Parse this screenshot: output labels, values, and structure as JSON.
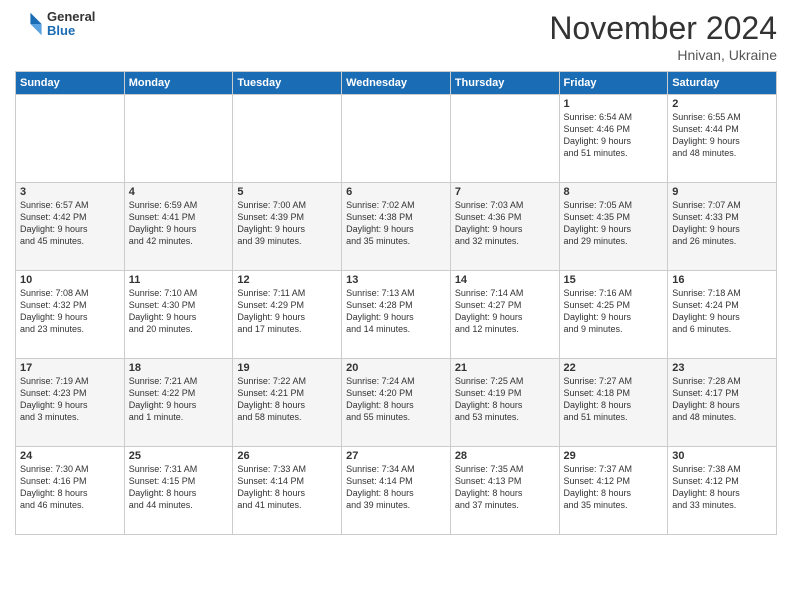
{
  "header": {
    "logo_line1": "General",
    "logo_line2": "Blue",
    "month": "November 2024",
    "location": "Hnivan, Ukraine"
  },
  "weekdays": [
    "Sunday",
    "Monday",
    "Tuesday",
    "Wednesday",
    "Thursday",
    "Friday",
    "Saturday"
  ],
  "weeks": [
    [
      {
        "num": "",
        "info": ""
      },
      {
        "num": "",
        "info": ""
      },
      {
        "num": "",
        "info": ""
      },
      {
        "num": "",
        "info": ""
      },
      {
        "num": "",
        "info": ""
      },
      {
        "num": "1",
        "info": "Sunrise: 6:54 AM\nSunset: 4:46 PM\nDaylight: 9 hours\nand 51 minutes."
      },
      {
        "num": "2",
        "info": "Sunrise: 6:55 AM\nSunset: 4:44 PM\nDaylight: 9 hours\nand 48 minutes."
      }
    ],
    [
      {
        "num": "3",
        "info": "Sunrise: 6:57 AM\nSunset: 4:42 PM\nDaylight: 9 hours\nand 45 minutes."
      },
      {
        "num": "4",
        "info": "Sunrise: 6:59 AM\nSunset: 4:41 PM\nDaylight: 9 hours\nand 42 minutes."
      },
      {
        "num": "5",
        "info": "Sunrise: 7:00 AM\nSunset: 4:39 PM\nDaylight: 9 hours\nand 39 minutes."
      },
      {
        "num": "6",
        "info": "Sunrise: 7:02 AM\nSunset: 4:38 PM\nDaylight: 9 hours\nand 35 minutes."
      },
      {
        "num": "7",
        "info": "Sunrise: 7:03 AM\nSunset: 4:36 PM\nDaylight: 9 hours\nand 32 minutes."
      },
      {
        "num": "8",
        "info": "Sunrise: 7:05 AM\nSunset: 4:35 PM\nDaylight: 9 hours\nand 29 minutes."
      },
      {
        "num": "9",
        "info": "Sunrise: 7:07 AM\nSunset: 4:33 PM\nDaylight: 9 hours\nand 26 minutes."
      }
    ],
    [
      {
        "num": "10",
        "info": "Sunrise: 7:08 AM\nSunset: 4:32 PM\nDaylight: 9 hours\nand 23 minutes."
      },
      {
        "num": "11",
        "info": "Sunrise: 7:10 AM\nSunset: 4:30 PM\nDaylight: 9 hours\nand 20 minutes."
      },
      {
        "num": "12",
        "info": "Sunrise: 7:11 AM\nSunset: 4:29 PM\nDaylight: 9 hours\nand 17 minutes."
      },
      {
        "num": "13",
        "info": "Sunrise: 7:13 AM\nSunset: 4:28 PM\nDaylight: 9 hours\nand 14 minutes."
      },
      {
        "num": "14",
        "info": "Sunrise: 7:14 AM\nSunset: 4:27 PM\nDaylight: 9 hours\nand 12 minutes."
      },
      {
        "num": "15",
        "info": "Sunrise: 7:16 AM\nSunset: 4:25 PM\nDaylight: 9 hours\nand 9 minutes."
      },
      {
        "num": "16",
        "info": "Sunrise: 7:18 AM\nSunset: 4:24 PM\nDaylight: 9 hours\nand 6 minutes."
      }
    ],
    [
      {
        "num": "17",
        "info": "Sunrise: 7:19 AM\nSunset: 4:23 PM\nDaylight: 9 hours\nand 3 minutes."
      },
      {
        "num": "18",
        "info": "Sunrise: 7:21 AM\nSunset: 4:22 PM\nDaylight: 9 hours\nand 1 minute."
      },
      {
        "num": "19",
        "info": "Sunrise: 7:22 AM\nSunset: 4:21 PM\nDaylight: 8 hours\nand 58 minutes."
      },
      {
        "num": "20",
        "info": "Sunrise: 7:24 AM\nSunset: 4:20 PM\nDaylight: 8 hours\nand 55 minutes."
      },
      {
        "num": "21",
        "info": "Sunrise: 7:25 AM\nSunset: 4:19 PM\nDaylight: 8 hours\nand 53 minutes."
      },
      {
        "num": "22",
        "info": "Sunrise: 7:27 AM\nSunset: 4:18 PM\nDaylight: 8 hours\nand 51 minutes."
      },
      {
        "num": "23",
        "info": "Sunrise: 7:28 AM\nSunset: 4:17 PM\nDaylight: 8 hours\nand 48 minutes."
      }
    ],
    [
      {
        "num": "24",
        "info": "Sunrise: 7:30 AM\nSunset: 4:16 PM\nDaylight: 8 hours\nand 46 minutes."
      },
      {
        "num": "25",
        "info": "Sunrise: 7:31 AM\nSunset: 4:15 PM\nDaylight: 8 hours\nand 44 minutes."
      },
      {
        "num": "26",
        "info": "Sunrise: 7:33 AM\nSunset: 4:14 PM\nDaylight: 8 hours\nand 41 minutes."
      },
      {
        "num": "27",
        "info": "Sunrise: 7:34 AM\nSunset: 4:14 PM\nDaylight: 8 hours\nand 39 minutes."
      },
      {
        "num": "28",
        "info": "Sunrise: 7:35 AM\nSunset: 4:13 PM\nDaylight: 8 hours\nand 37 minutes."
      },
      {
        "num": "29",
        "info": "Sunrise: 7:37 AM\nSunset: 4:12 PM\nDaylight: 8 hours\nand 35 minutes."
      },
      {
        "num": "30",
        "info": "Sunrise: 7:38 AM\nSunset: 4:12 PM\nDaylight: 8 hours\nand 33 minutes."
      }
    ]
  ]
}
